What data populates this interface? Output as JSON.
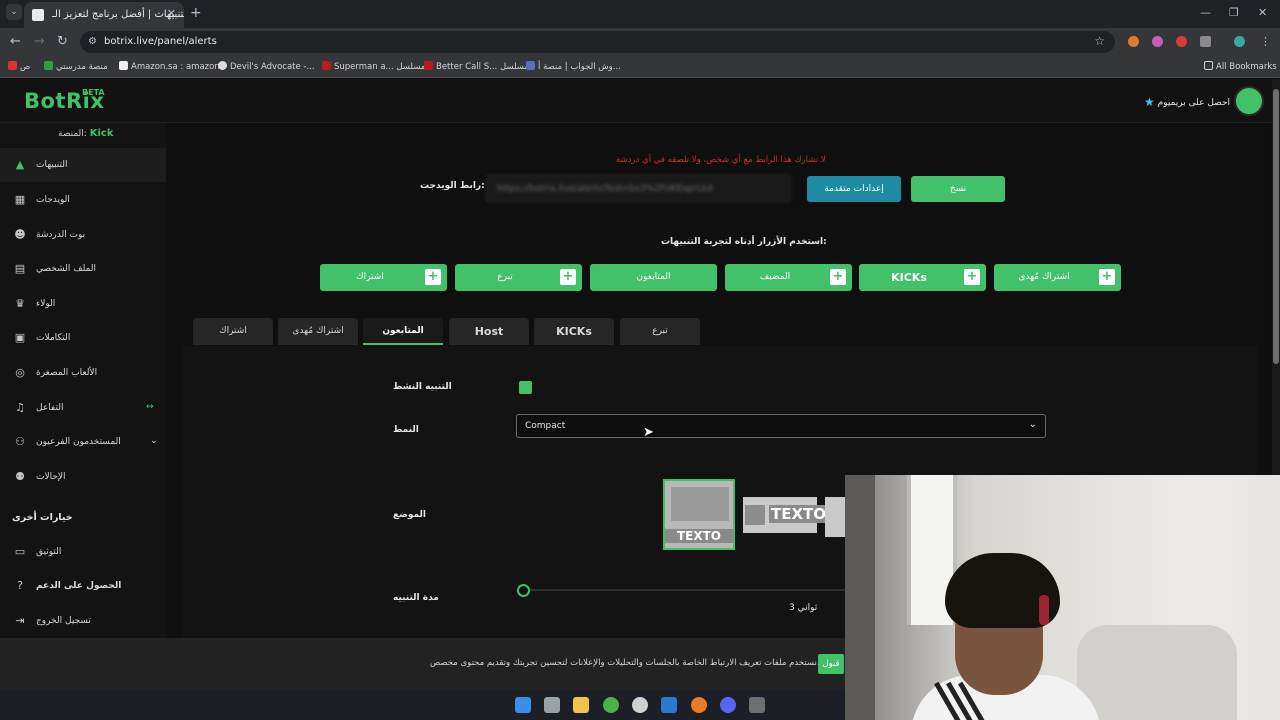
{
  "browser": {
    "tab_title": "التنبيهات | أفضل برنامج لتعزيز الـ",
    "url": "botrix.live/panel/alerts",
    "bookmarks": [
      "ص",
      "منصة مدرستي",
      "Amazon.sa : amazon",
      "Devil's Advocate -...",
      "Superman a... مسلسل",
      "Better Call S... مسلسل",
      "وش الجواب | منصة أ..."
    ],
    "all_bookmarks": "All Bookmarks"
  },
  "app": {
    "logo": "BotRix",
    "beta": "BETA",
    "premium": "احصل على بريميوم",
    "platform_label": "المنصة:",
    "platform_value": "Kick"
  },
  "sidebar": {
    "items": [
      {
        "label": "التنبيهات",
        "icon": "warning-icon"
      },
      {
        "label": "الويدجات",
        "icon": "widgets-icon"
      },
      {
        "label": "بوت الدردشة",
        "icon": "robot-icon"
      },
      {
        "label": "الملف الشخصي",
        "icon": "profile-card-icon"
      },
      {
        "label": "الولاء",
        "icon": "trophy-icon"
      },
      {
        "label": "التكاملات",
        "icon": "integration-icon"
      },
      {
        "label": "الألعاب المصغرة",
        "icon": "gamepad-icon"
      },
      {
        "label": "التفاعل",
        "icon": "music-icon"
      },
      {
        "label": "المستخدمون الفرعيون",
        "icon": "users-icon"
      },
      {
        "label": "الإحالات",
        "icon": "referrals-icon"
      }
    ],
    "other_options_title": "خيارات أخرى",
    "other_items": [
      {
        "label": "التوثيق",
        "icon": "docs-icon"
      },
      {
        "label": "الحصول على الدعم",
        "icon": "help-icon"
      },
      {
        "label": "تسجيل الخروج",
        "icon": "logout-icon"
      }
    ]
  },
  "widget": {
    "warning": "لا تشارك هذا الرابط مع أي شخص، ولا تلصقه في أي دردشة",
    "label": "رابط الويدجت:",
    "url_placeholder": "https://botrix.live/alerts?bid=bx3%2FoKExprLkd",
    "advanced_button": "إعدادات متقدمة",
    "copy_button": "نسخ"
  },
  "test": {
    "hint": "استخدم الأزرار أدناه لتجربة التنبيهات:",
    "buttons": [
      "اشتراك",
      "تبرع",
      "المتابعون",
      "المضيف",
      "KICKs",
      "اشتراك مُهدى"
    ]
  },
  "tabs": [
    "اشتراك",
    "اشتراك مُهدى",
    "المتابعون",
    "Host",
    "KICKs",
    "تبرع"
  ],
  "form": {
    "active_label": "التنبيه النشط",
    "style_label": "النمط",
    "style_value": "Compact",
    "position_label": "الموضع",
    "position_text": "TEXTO",
    "duration_label": "مدة التنبيه",
    "duration_value": "ثواني 3"
  },
  "cookie": {
    "text": "نستخدم ملفات تعريف الارتباط الخاصة بالجلسات والتحليلات والإعلانات لتحسين تجربتك وتقديم محتوى مخصص.",
    "accept": "قبول"
  },
  "colors": {
    "accent": "#43c06a",
    "teal": "#1f8aa4",
    "warning": "#c9302c"
  }
}
